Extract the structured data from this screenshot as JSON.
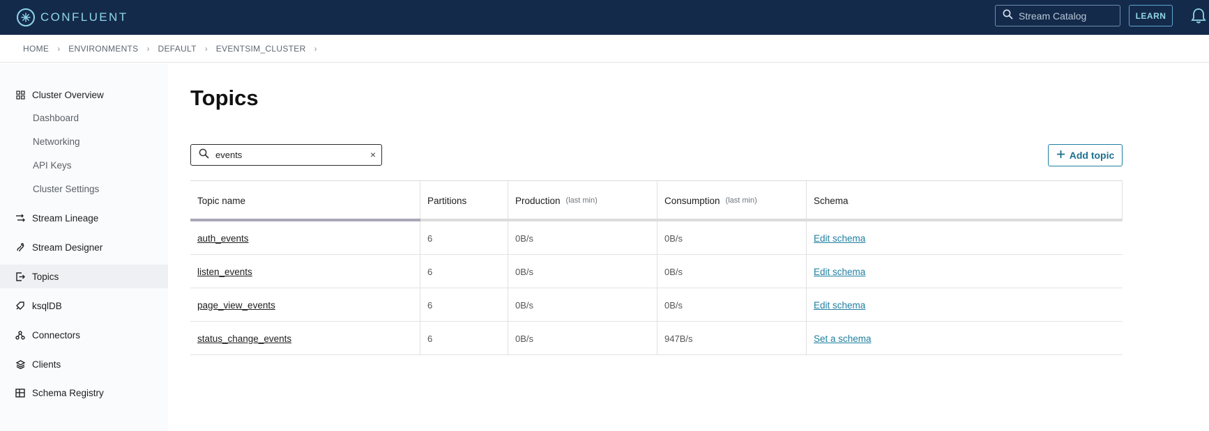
{
  "header": {
    "brand": "CONFLUENT",
    "search_placeholder": "Stream Catalog",
    "learn_label": "LEARN"
  },
  "breadcrumb": [
    "HOME",
    "ENVIRONMENTS",
    "DEFAULT",
    "EVENTSIM_CLUSTER"
  ],
  "sidebar": {
    "cluster_overview": "Cluster Overview",
    "sub_items": [
      "Dashboard",
      "Networking",
      "API Keys",
      "Cluster Settings"
    ],
    "items": [
      "Stream Lineage",
      "Stream Designer",
      "Topics",
      "ksqlDB",
      "Connectors",
      "Clients",
      "Schema Registry"
    ],
    "active": "Topics"
  },
  "main": {
    "title": "Topics",
    "filter_value": "events",
    "add_topic_label": "Add topic"
  },
  "table": {
    "columns": [
      {
        "label": "Topic name",
        "hint": ""
      },
      {
        "label": "Partitions",
        "hint": ""
      },
      {
        "label": "Production",
        "hint": "(last min)"
      },
      {
        "label": "Consumption",
        "hint": "(last min)"
      },
      {
        "label": "Schema",
        "hint": ""
      }
    ],
    "rows": [
      {
        "name": "auth_events",
        "partitions": "6",
        "production": "0B/s",
        "consumption": "0B/s",
        "schema": "Edit schema"
      },
      {
        "name": "listen_events",
        "partitions": "6",
        "production": "0B/s",
        "consumption": "0B/s",
        "schema": "Edit schema"
      },
      {
        "name": "page_view_events",
        "partitions": "6",
        "production": "0B/s",
        "consumption": "0B/s",
        "schema": "Edit schema"
      },
      {
        "name": "status_change_events",
        "partitions": "6",
        "production": "0B/s",
        "consumption": "947B/s",
        "schema": "Set a schema"
      }
    ]
  },
  "colors": {
    "topbar": "#142a4b",
    "accent": "#1f7fa0",
    "logo": "#8fd6e8"
  }
}
